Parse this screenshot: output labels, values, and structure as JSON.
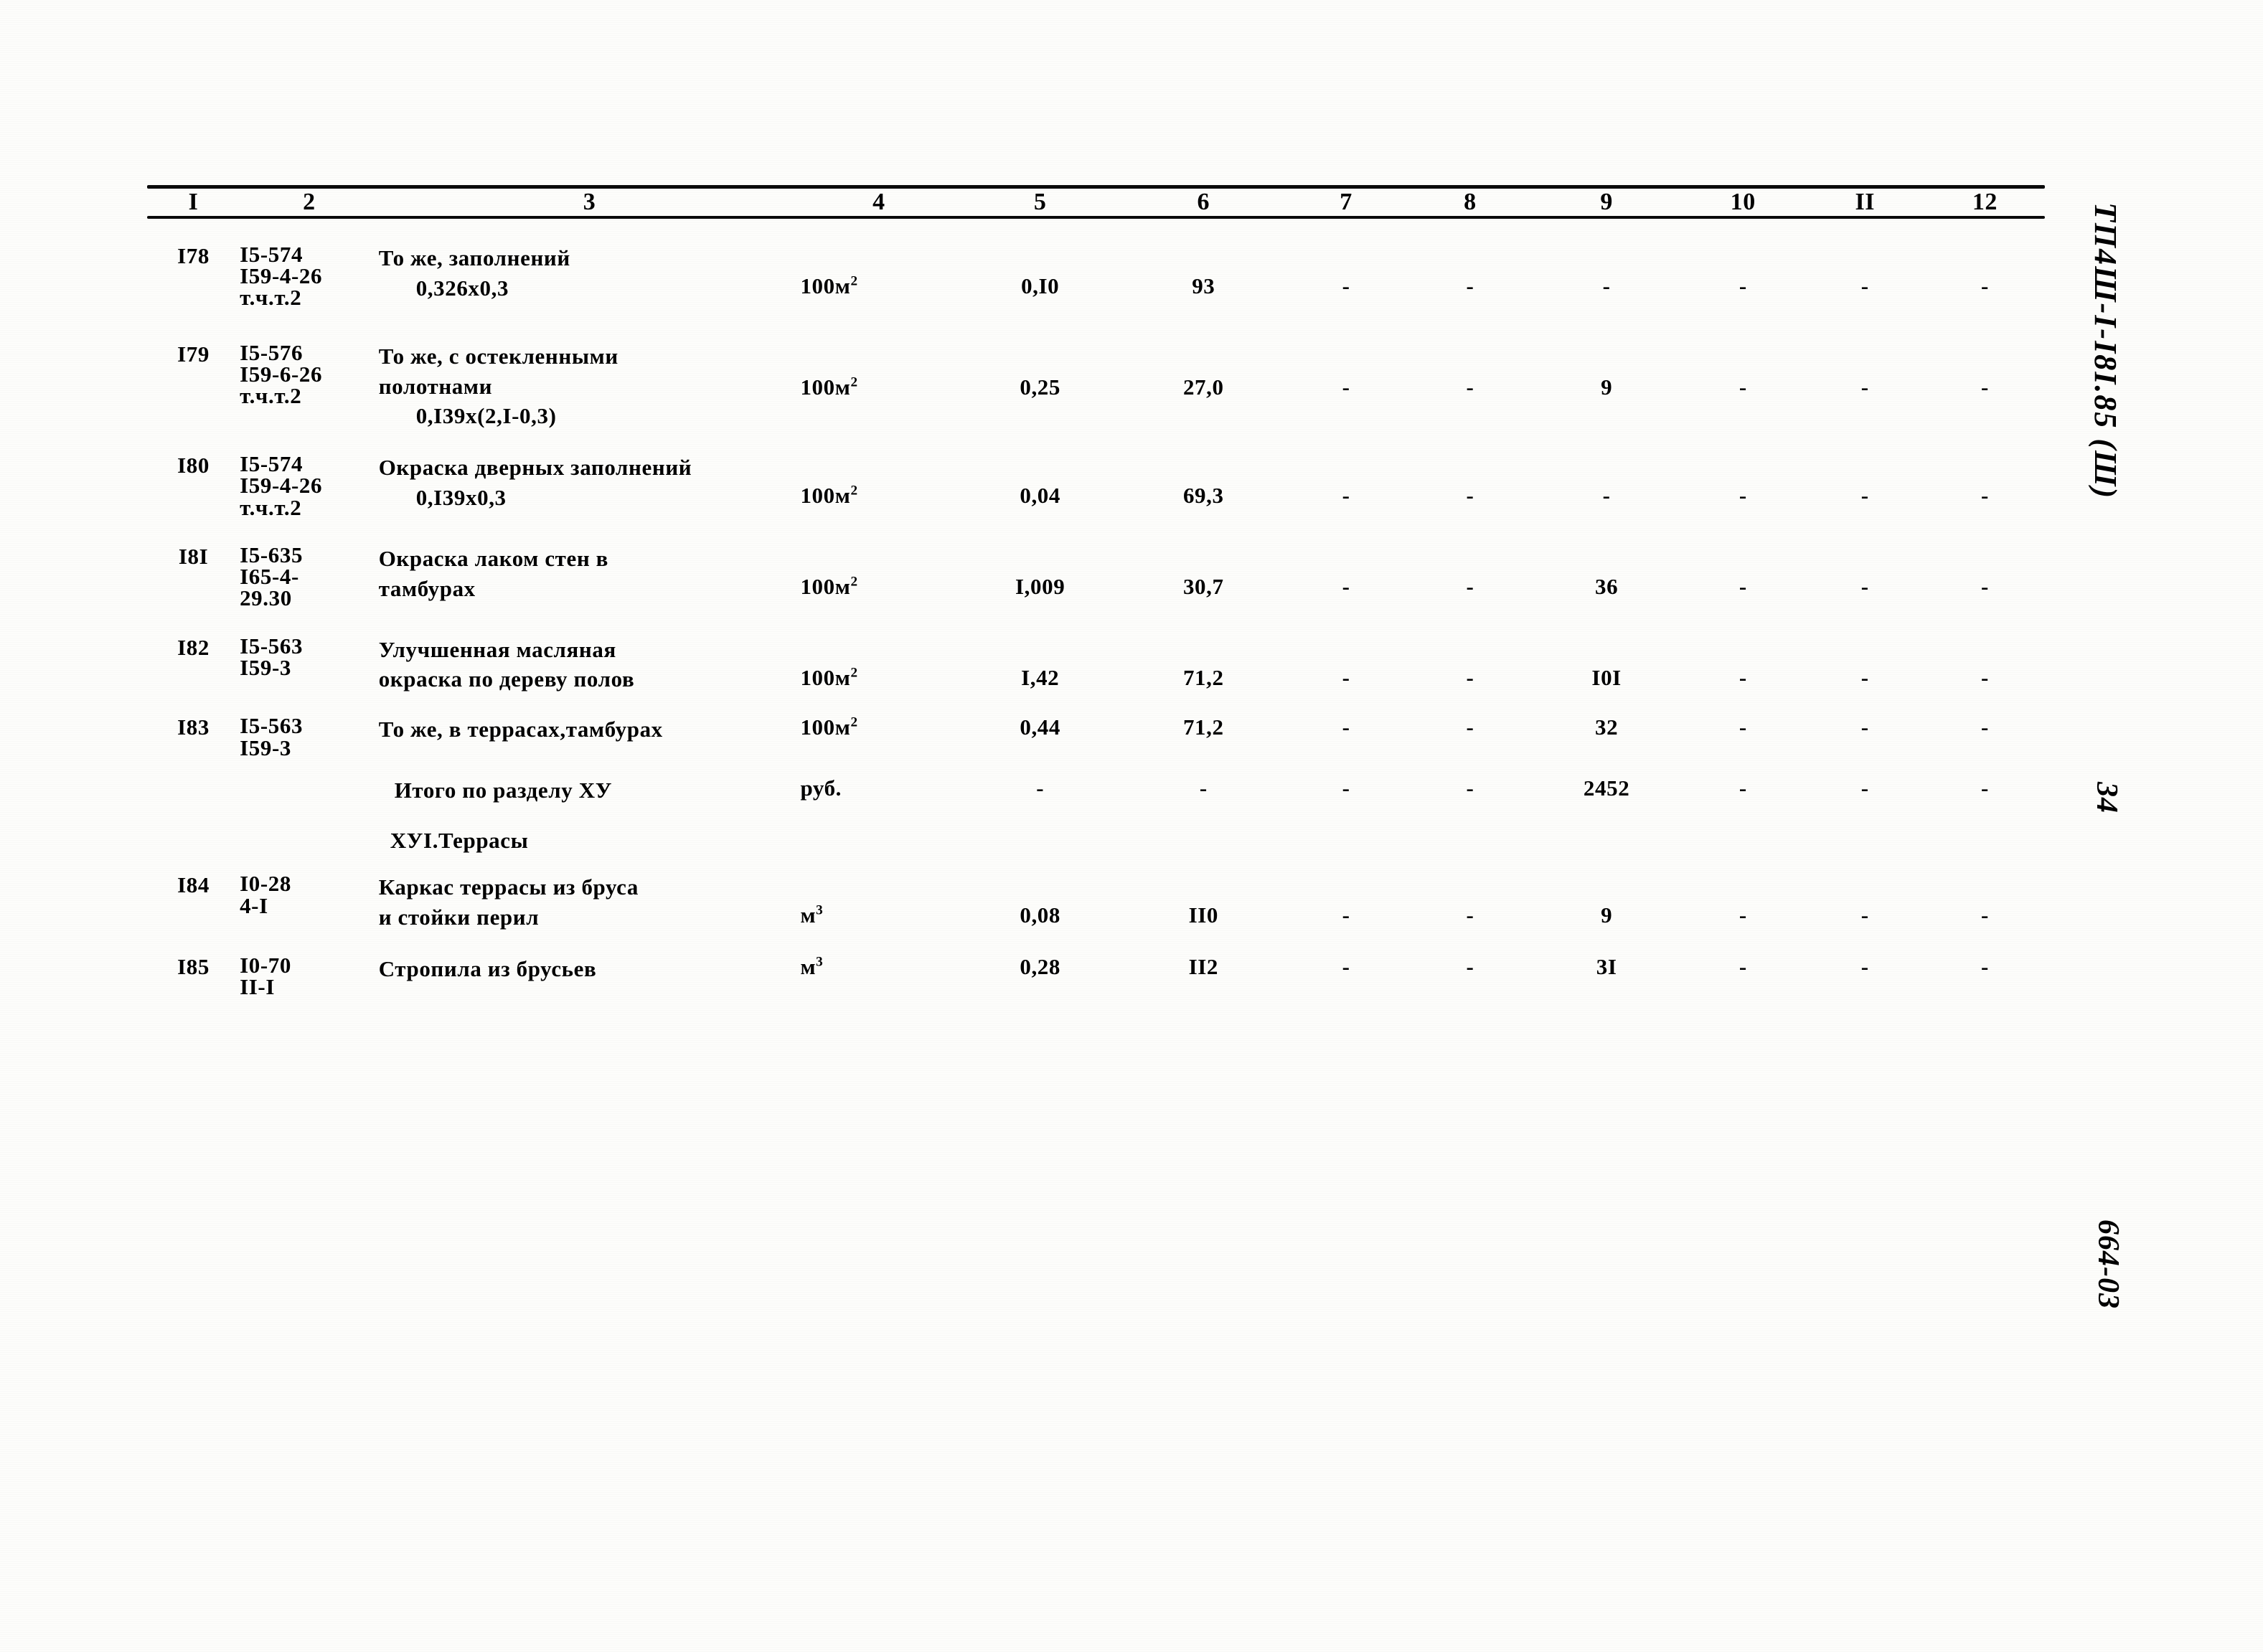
{
  "document": {
    "doc_code_vertical": "ТП4Ш-I-I8I.85 (Ш)",
    "page_number_vertical": "34",
    "sheet_code_vertical": "664-03"
  },
  "table": {
    "column_headers": [
      "I",
      "2",
      "3",
      "4",
      "5",
      "6",
      "7",
      "8",
      "9",
      "10",
      "II",
      "12"
    ],
    "rows": [
      {
        "kind": "item",
        "no": "I78",
        "code_lines": [
          "I5-574",
          "I59-4-26",
          "т.ч.т.2"
        ],
        "desc_lines": [
          "То же, заполнений",
          "0,326х0,3"
        ],
        "unit": "100м",
        "unit_sup": "2",
        "c5": "0,I0",
        "c6": "93",
        "c7": "-",
        "c8": "-",
        "c9": "-",
        "c10": "-",
        "c11": "-",
        "c12": "-"
      },
      {
        "kind": "item",
        "no": "I79",
        "code_lines": [
          "I5-576",
          "I59-6-26",
          "т.ч.т.2"
        ],
        "desc_lines": [
          "То же, с остекленными",
          "полотнами",
          "0,I39х(2,I-0,3)"
        ],
        "unit": "100м",
        "unit_sup": "2",
        "c5": "0,25",
        "c6": "27,0",
        "c7": "-",
        "c8": "-",
        "c9": "9",
        "c10": "-",
        "c11": "-",
        "c12": "-"
      },
      {
        "kind": "item",
        "no": "I80",
        "code_lines": [
          "I5-574",
          "I59-4-26",
          "т.ч.т.2"
        ],
        "desc_lines": [
          "Окраска дверных заполнений",
          "0,I39х0,3"
        ],
        "unit": "100м",
        "unit_sup": "2",
        "c5": "0,04",
        "c6": "69,3",
        "c7": "-",
        "c8": "-",
        "c9": "-",
        "c10": "-",
        "c11": "-",
        "c12": "-"
      },
      {
        "kind": "item",
        "no": "I8I",
        "code_lines": [
          "I5-635",
          "I65-4-",
          "29.30"
        ],
        "desc_lines": [
          "Окраска лаком стен в",
          "тамбурах"
        ],
        "unit": "100м",
        "unit_sup": "2",
        "c5": "I,009",
        "c6": "30,7",
        "c7": "-",
        "c8": "-",
        "c9": "36",
        "c10": "-",
        "c11": "-",
        "c12": "-"
      },
      {
        "kind": "item",
        "no": "I82",
        "code_lines": [
          "I5-563",
          "I59-3"
        ],
        "desc_lines": [
          "Улучшенная масляная",
          "окраска по дереву полов"
        ],
        "unit": "100м",
        "unit_sup": "2",
        "c5": "I,42",
        "c6": "71,2",
        "c7": "-",
        "c8": "-",
        "c9": "I0I",
        "c10": "-",
        "c11": "-",
        "c12": "-"
      },
      {
        "kind": "item",
        "no": "I83",
        "code_lines": [
          "I5-563",
          "I59-3"
        ],
        "desc_lines": [
          "То же, в террасах,тамбурах"
        ],
        "unit": "100м",
        "unit_sup": "2",
        "c5": "0,44",
        "c6": "71,2",
        "c7": "-",
        "c8": "-",
        "c9": "32",
        "c10": "-",
        "c11": "-",
        "c12": "-"
      },
      {
        "kind": "total",
        "no": "",
        "code_lines": [],
        "desc_lines": [
          "Итого по разделу ХУ"
        ],
        "unit": "руб.",
        "unit_sup": "",
        "c5": "-",
        "c6": "-",
        "c7": "-",
        "c8": "-",
        "c9": "2452",
        "c10": "-",
        "c11": "-",
        "c12": "-"
      },
      {
        "kind": "section",
        "no": "",
        "code_lines": [],
        "desc_lines": [
          "ХУI.Террасы"
        ],
        "unit": "",
        "unit_sup": "",
        "c5": "",
        "c6": "",
        "c7": "",
        "c8": "",
        "c9": "",
        "c10": "",
        "c11": "",
        "c12": ""
      },
      {
        "kind": "item",
        "no": "I84",
        "code_lines": [
          "I0-28",
          "4-I"
        ],
        "desc_lines": [
          "Каркас террасы из бруса",
          "и стойки перил"
        ],
        "unit": "м",
        "unit_sup": "3",
        "c5": "0,08",
        "c6": "II0",
        "c7": "-",
        "c8": "-",
        "c9": "9",
        "c10": "-",
        "c11": "-",
        "c12": "-"
      },
      {
        "kind": "item",
        "no": "I85",
        "code_lines": [
          "I0-70",
          "II-I"
        ],
        "desc_lines": [
          "Стропила из брусьев"
        ],
        "unit": "м",
        "unit_sup": "3",
        "c5": "0,28",
        "c6": "II2",
        "c7": "-",
        "c8": "-",
        "c9": "3I",
        "c10": "-",
        "c11": "-",
        "c12": "-"
      }
    ]
  }
}
